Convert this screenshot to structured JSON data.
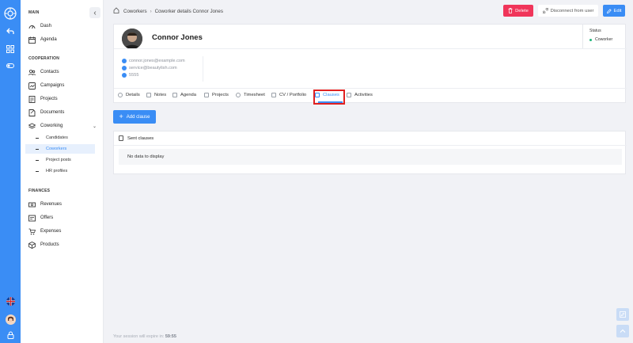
{
  "rail": {
    "icons": [
      "logo-icon",
      "undo-icon",
      "grid-icon",
      "toggle-icon",
      "uk-flag-icon",
      "user-avatar",
      "lock-icon"
    ]
  },
  "sidebar": {
    "main_title": "MAIN",
    "main_items": [
      {
        "label": "Dash",
        "icon": "gauge-icon"
      },
      {
        "label": "Agenda",
        "icon": "calendar-icon"
      }
    ],
    "cooperation_title": "COOPERATION",
    "cooperation_items": [
      {
        "label": "Contacts",
        "icon": "contacts-icon"
      },
      {
        "label": "Campaigns",
        "icon": "campaigns-icon"
      },
      {
        "label": "Projects",
        "icon": "projects-icon"
      },
      {
        "label": "Documents",
        "icon": "documents-icon"
      },
      {
        "label": "Coworking",
        "icon": "layers-icon"
      }
    ],
    "coworking_sub": [
      {
        "label": "Candidates",
        "active": false
      },
      {
        "label": "Coworkers",
        "active": true
      },
      {
        "label": "Project posts",
        "active": false
      },
      {
        "label": "HR profiles",
        "active": false
      }
    ],
    "finances_title": "FINANCES",
    "finances_items": [
      {
        "label": "Revenues",
        "icon": "revenues-icon"
      },
      {
        "label": "Offers",
        "icon": "offers-icon"
      },
      {
        "label": "Expenses",
        "icon": "cart-icon"
      },
      {
        "label": "Products",
        "icon": "box-icon"
      }
    ]
  },
  "breadcrumb": {
    "root": "Coworkers",
    "separator": "›",
    "current": "Coworker details Connor Jones"
  },
  "actions": {
    "delete": "Delete",
    "disconnect": "Disconnect from user",
    "edit": "Edit"
  },
  "profile": {
    "name": "Connor Jones",
    "status_label": "Status",
    "status_value": "Coworker",
    "contacts": [
      "connor.jones@example.com",
      "service@beautylish.com",
      "5555"
    ]
  },
  "tabs": [
    {
      "label": "Details",
      "active": false
    },
    {
      "label": "Notes",
      "active": false
    },
    {
      "label": "Agenda",
      "active": false
    },
    {
      "label": "Projects",
      "active": false
    },
    {
      "label": "Timesheet",
      "active": false
    },
    {
      "label": "CV / Portfolio",
      "active": false
    },
    {
      "label": "Clauses",
      "active": true
    },
    {
      "label": "Activities",
      "active": false
    }
  ],
  "add_clause": "Add clause",
  "sent_clauses": {
    "title": "Sent clauses",
    "empty": "No data to display"
  },
  "session": {
    "text": "Your session will expire in:",
    "time": "59:55"
  },
  "colors": {
    "accent": "#3a8df5",
    "danger": "#f0355a",
    "status": "#1fb67a",
    "highlight": "#e02020"
  }
}
